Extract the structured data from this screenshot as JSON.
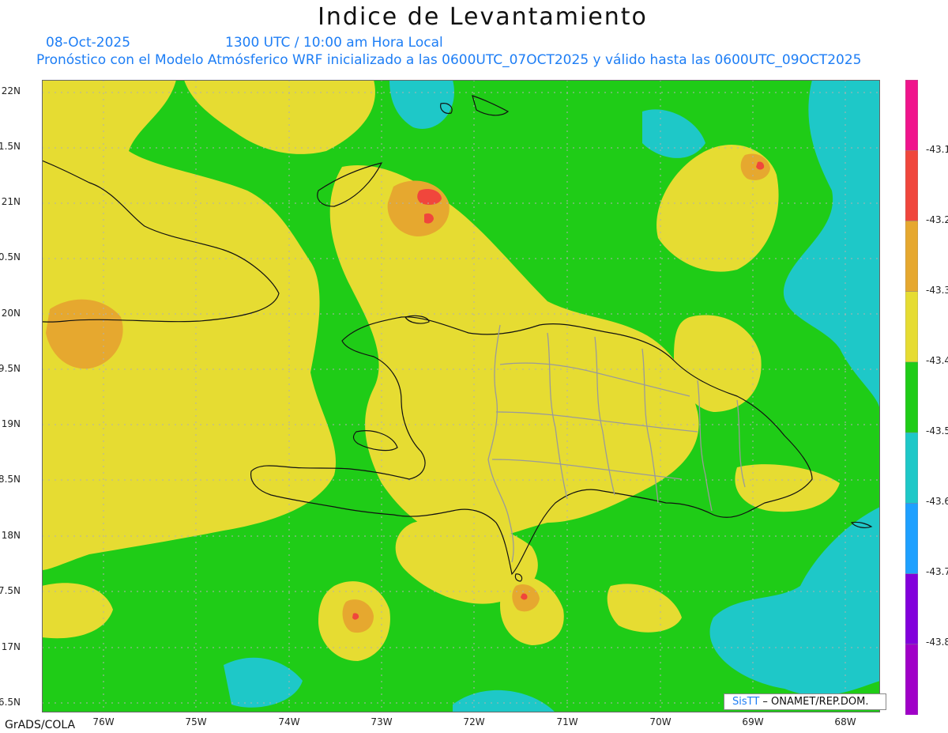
{
  "header": {
    "title": "Indice de Levantamiento",
    "date": "08-Oct-2025",
    "time": "1300 UTC / 10:00 am Hora Local",
    "model": "Pronóstico con el Modelo Atmósferico WRF inicializado a las 0600UTC_07OCT2025 y válido hasta las  0600UTC_09OCT2025"
  },
  "lat_labels": [
    "22N",
    "21.5N",
    "21N",
    "20.5N",
    "20N",
    "19.5N",
    "19N",
    "18.5N",
    "18N",
    "17.5N",
    "17N",
    "16.5N"
  ],
  "lon_labels": [
    "76W",
    "75W",
    "74W",
    "73W",
    "72W",
    "71W",
    "70W",
    "69W",
    "68W"
  ],
  "colorbar": {
    "labels": [
      "-43.1",
      "-43.2",
      "-43.3",
      "-43.4",
      "-43.5",
      "-43.6",
      "-43.7",
      "-43.8"
    ],
    "colors": [
      "#f0148c",
      "#f0463c",
      "#e6a82f",
      "#e6dc32",
      "#1fcc17",
      "#1ec8c8",
      "#1ea0ff",
      "#8200dc",
      "#a000c8"
    ]
  },
  "map_colors": {
    "land_green": "#1fcc17",
    "yellow": "#e6dc32",
    "orange": "#e6a82f",
    "red": "#f0463c",
    "cyan": "#1ec8c8",
    "blue": "#1ea0ff"
  },
  "credit": "GrADS/COLA",
  "watermark": {
    "logo": "SisTT",
    "text": " – ONAMET/REP.DOM."
  }
}
